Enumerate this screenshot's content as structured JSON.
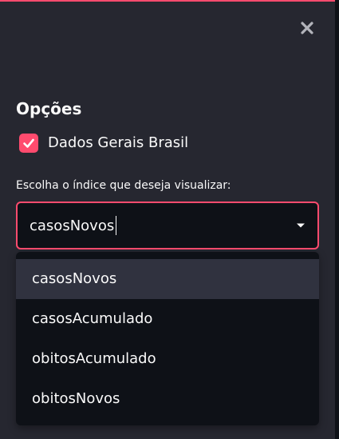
{
  "sidebar": {
    "close_icon": "close-icon",
    "accent_color": "#ff4b6e",
    "heading": "Opções",
    "checkbox": {
      "label": "Dados Gerais Brasil",
      "checked": true
    },
    "select": {
      "label": "Escolha o índice que deseja visualizar:",
      "value": "casosNovos",
      "arrow_icon": "caret-down-icon",
      "options": [
        {
          "label": "casosNovos",
          "highlighted": true
        },
        {
          "label": "casosAcumulado",
          "highlighted": false
        },
        {
          "label": "obitosAcumulado",
          "highlighted": false
        },
        {
          "label": "obitosNovos",
          "highlighted": false
        }
      ]
    }
  }
}
